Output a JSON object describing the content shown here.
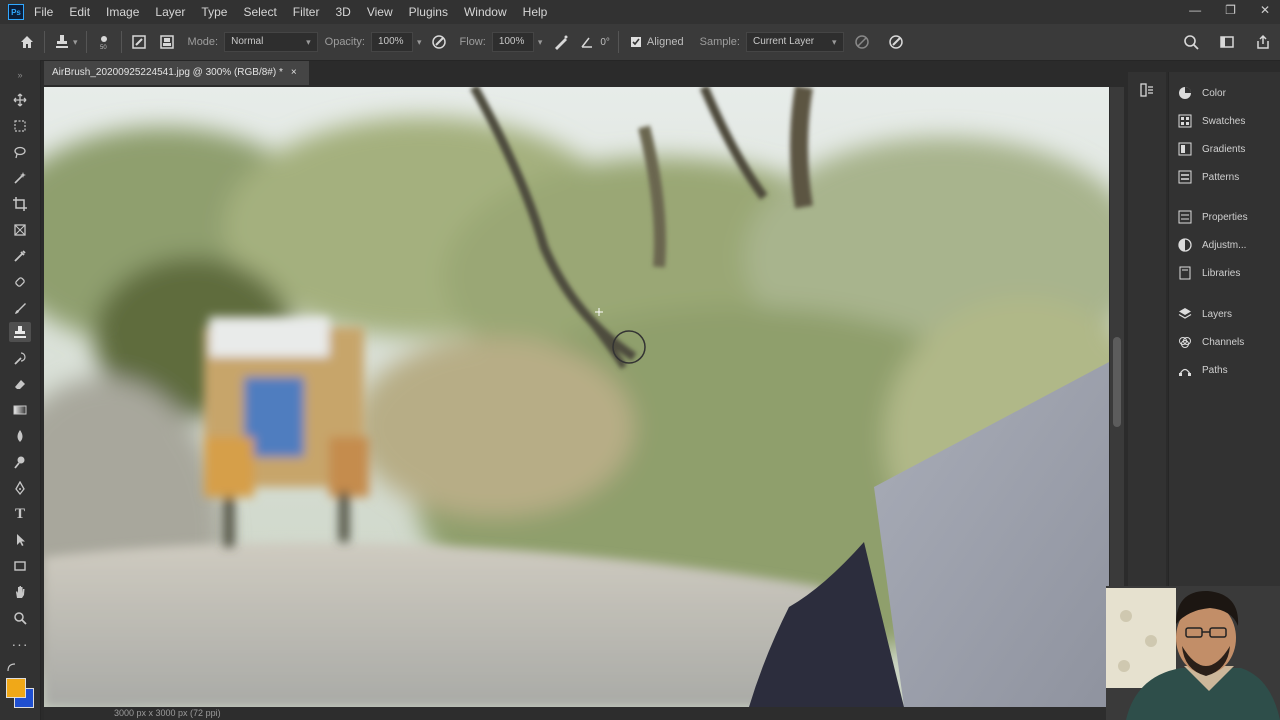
{
  "app": {
    "logo": "Ps"
  },
  "menu": [
    "File",
    "Edit",
    "Image",
    "Layer",
    "Type",
    "Select",
    "Filter",
    "3D",
    "View",
    "Plugins",
    "Window",
    "Help"
  ],
  "window_controls": [
    "—",
    "❐",
    "✕"
  ],
  "options_bar": {
    "mode_label": "Mode:",
    "mode_value": "Normal",
    "opacity_label": "Opacity:",
    "opacity_value": "100%",
    "flow_label": "Flow:",
    "flow_value": "100%",
    "angle_value": "0°",
    "aligned_label": "Aligned",
    "sample_label": "Sample:",
    "sample_value": "Current Layer"
  },
  "document": {
    "tab_title": "AirBrush_20200925224541.jpg @ 300% (RGB/8#) *",
    "close_glyph": "×"
  },
  "status": {
    "text": "3000 px x 3000 px (72 ppi)"
  },
  "panels": [
    {
      "label": "Color",
      "icon": "color-wheel-icon"
    },
    {
      "label": "Swatches",
      "icon": "swatches-icon"
    },
    {
      "label": "Gradients",
      "icon": "gradients-icon"
    },
    {
      "label": "Patterns",
      "icon": "patterns-icon"
    },
    {
      "label": "Properties",
      "icon": "properties-icon"
    },
    {
      "label": "Adjustm...",
      "icon": "adjustments-icon"
    },
    {
      "label": "Libraries",
      "icon": "libraries-icon"
    },
    {
      "label": "Layers",
      "icon": "layers-icon"
    },
    {
      "label": "Channels",
      "icon": "channels-icon"
    },
    {
      "label": "Paths",
      "icon": "paths-icon"
    }
  ],
  "colors": {
    "foreground": "#f0a818",
    "background": "#1f4fd0",
    "accent": "#31a8ff"
  }
}
